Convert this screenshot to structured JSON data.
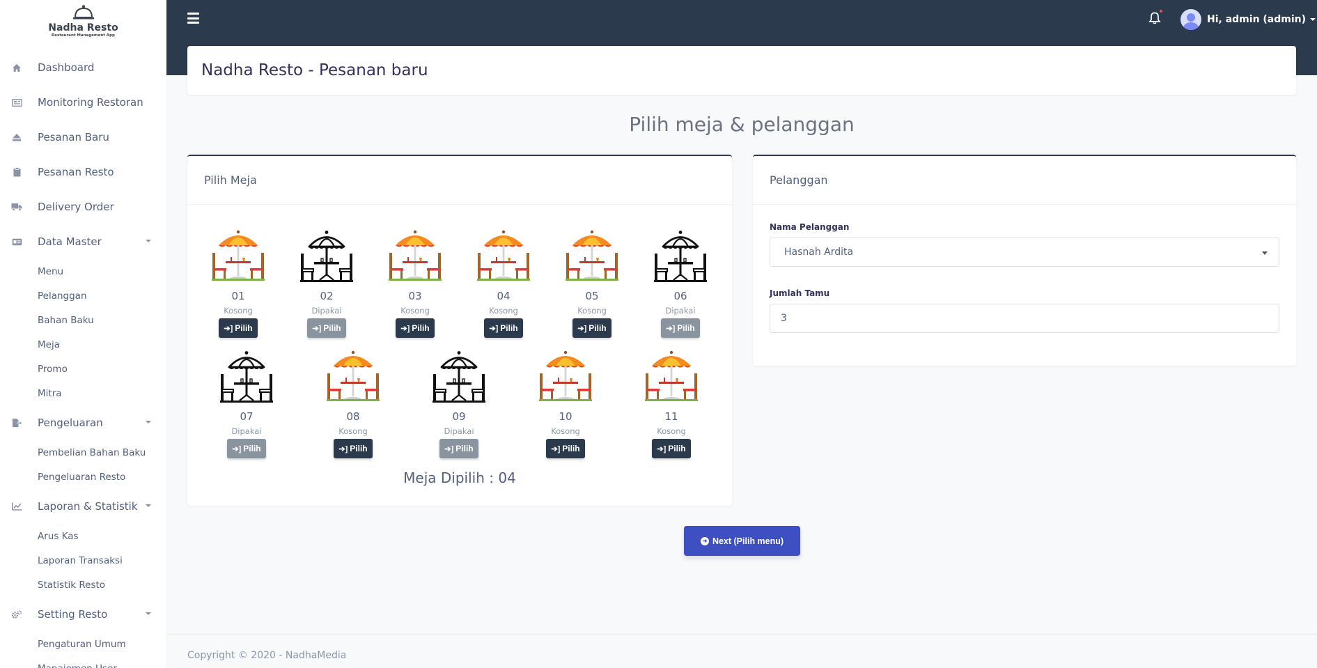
{
  "brand": {
    "name": "Nadha Resto",
    "tagline": "Restaurant Management App"
  },
  "sidebar": {
    "items": [
      {
        "label": "Dashboard",
        "icon": "home-icon"
      },
      {
        "label": "Monitoring Restoran",
        "icon": "monitor-icon"
      },
      {
        "label": "Pesanan Baru",
        "icon": "eject-icon"
      },
      {
        "label": "Pesanan Resto",
        "icon": "clipboard-icon"
      },
      {
        "label": "Delivery Order",
        "icon": "truck-icon"
      },
      {
        "label": "Data Master",
        "icon": "id-card-icon",
        "children": [
          "Menu",
          "Pelanggan",
          "Bahan Baku",
          "Meja",
          "Promo",
          "Mitra"
        ]
      },
      {
        "label": "Pengeluaran",
        "icon": "file-export-icon",
        "children": [
          "Pembelian Bahan Baku",
          "Pengeluaran Resto"
        ]
      },
      {
        "label": "Laporan & Statistik",
        "icon": "chart-line-icon",
        "children": [
          "Arus Kas",
          "Laporan Transaksi",
          "Statistik Resto"
        ]
      },
      {
        "label": "Setting Resto",
        "icon": "cogs-icon",
        "children": [
          "Pengaturan Umum",
          "Manajemen User"
        ]
      }
    ]
  },
  "topbar": {
    "user_label": "Hi, admin (admin)"
  },
  "header": {
    "title": "Nadha Resto - Pesanan baru"
  },
  "page": {
    "section_title": "Pilih meja & pelanggan"
  },
  "meja": {
    "card_title": "Pilih Meja",
    "button_label": "Pilih",
    "tables": [
      {
        "number": "01",
        "status": "Kosong",
        "available": true
      },
      {
        "number": "02",
        "status": "Dipakai",
        "available": false
      },
      {
        "number": "03",
        "status": "Kosong",
        "available": true
      },
      {
        "number": "04",
        "status": "Kosong",
        "available": true
      },
      {
        "number": "05",
        "status": "Kosong",
        "available": true
      },
      {
        "number": "06",
        "status": "Dipakai",
        "available": false
      },
      {
        "number": "07",
        "status": "Dipakai",
        "available": false
      },
      {
        "number": "08",
        "status": "Kosong",
        "available": true
      },
      {
        "number": "09",
        "status": "Dipakai",
        "available": false
      },
      {
        "number": "10",
        "status": "Kosong",
        "available": true
      },
      {
        "number": "11",
        "status": "Kosong",
        "available": true
      }
    ],
    "selected_label": "Meja Dipilih : 04"
  },
  "pelanggan": {
    "card_title": "Pelanggan",
    "nama_label": "Nama Pelanggan",
    "nama_value": "Hasnah Ardita",
    "jumlah_label": "Jumlah Tamu",
    "jumlah_value": "3"
  },
  "actions": {
    "next_label": "Next (Pilih menu)"
  },
  "footer": {
    "copyright": "Copyright © 2020 - NadhaMedia"
  },
  "colors": {
    "topbar": "#2c3a4e",
    "primary": "#3e4fc1",
    "umbrella_orange": "#f58a1f",
    "chair_brown": "#a0652a"
  }
}
